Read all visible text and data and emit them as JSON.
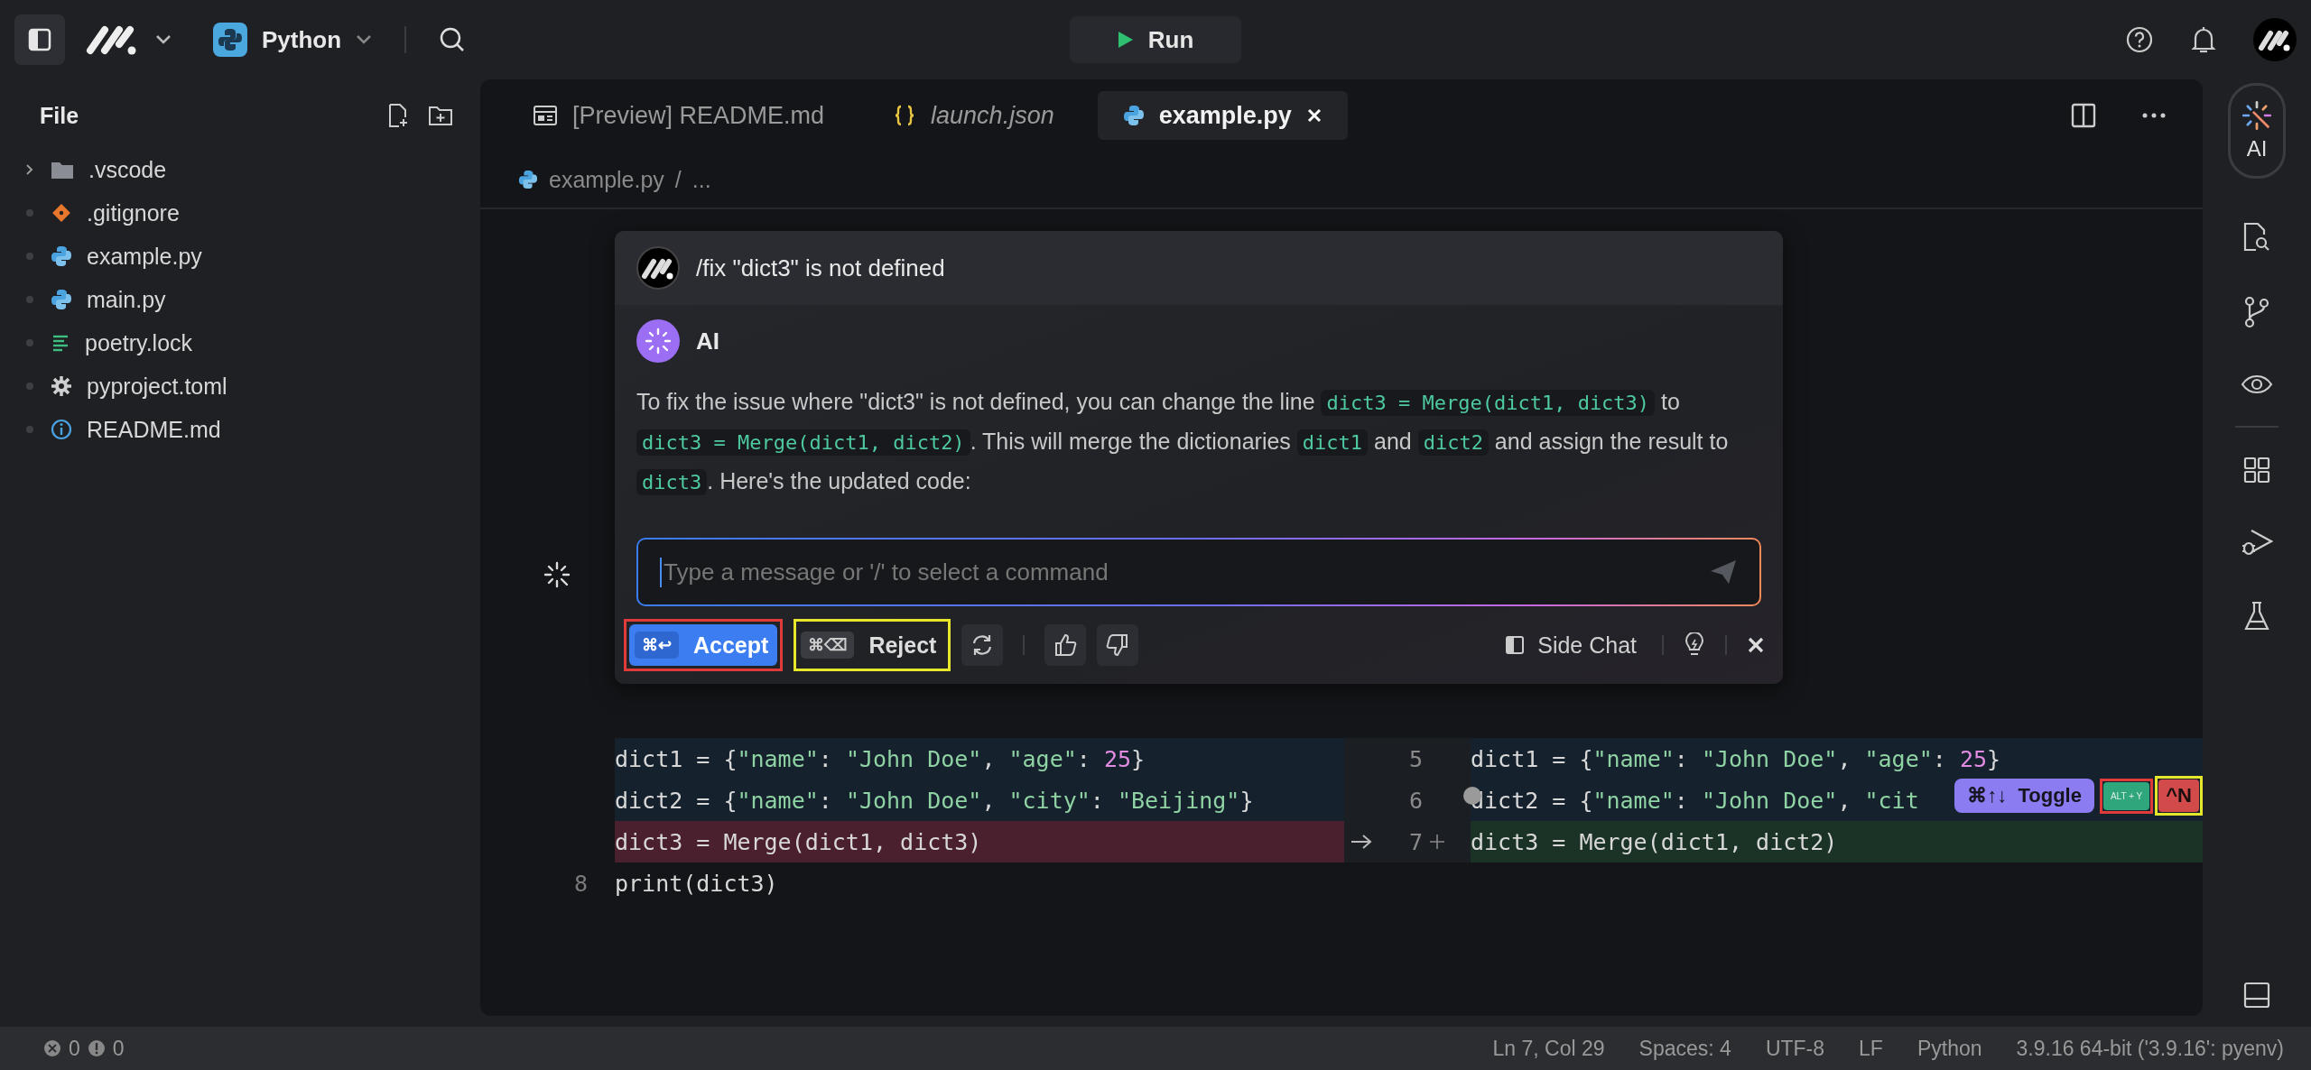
{
  "topbar": {
    "project": "Python",
    "run": "Run"
  },
  "sidebar": {
    "title": "File",
    "items": [
      {
        "name": ".vscode",
        "kind": "folder",
        "expanded": false
      },
      {
        "name": ".gitignore",
        "kind": "git"
      },
      {
        "name": "example.py",
        "kind": "python"
      },
      {
        "name": "main.py",
        "kind": "python"
      },
      {
        "name": "poetry.lock",
        "kind": "lock"
      },
      {
        "name": "pyproject.toml",
        "kind": "config"
      },
      {
        "name": "README.md",
        "kind": "info"
      }
    ]
  },
  "tabs": [
    {
      "label": "[Preview] README.md",
      "kind": "preview",
      "italic": false,
      "selected": false
    },
    {
      "label": "launch.json",
      "kind": "json",
      "italic": true,
      "selected": false
    },
    {
      "label": "example.py",
      "kind": "python",
      "italic": false,
      "selected": true
    }
  ],
  "breadcrumb": {
    "items": [
      "example.py",
      "..."
    ],
    "separator": "/"
  },
  "chat": {
    "command": "/fix \"dict3\" is not defined",
    "assistant": "AI",
    "message": [
      {
        "text": "To fix the issue where \"dict3\" is not defined, you can change the line ",
        "code": false
      },
      {
        "text": "dict3 = Merge(dict1, dict3)",
        "code": true
      },
      {
        "text": " to ",
        "code": false
      },
      {
        "text": "dict3 = Merge(dict1, dict2)",
        "code": true
      },
      {
        "text": ". This will merge the dictionaries ",
        "code": false
      },
      {
        "text": "dict1",
        "code": true
      },
      {
        "text": " and ",
        "code": false
      },
      {
        "text": "dict2",
        "code": true
      },
      {
        "text": " and assign the result to ",
        "code": false
      },
      {
        "text": "dict3",
        "code": true
      },
      {
        "text": ". Here's the updated code:",
        "code": false
      }
    ],
    "placeholder": "Type a message or '/' to select a command",
    "accept": {
      "shortcut": "⌘↩",
      "label": "Accept"
    },
    "reject": {
      "shortcut": "⌘⌫",
      "label": "Reject"
    },
    "side_chat": "Side Chat"
  },
  "diff": {
    "rows": [
      {
        "left": {
          "kind": "context",
          "tokens": [
            {
              "text": "dict1 = {",
              "kind": "plain"
            },
            {
              "text": "\"name\"",
              "kind": "string"
            },
            {
              "text": ": ",
              "kind": "plain"
            },
            {
              "text": "\"John Doe\"",
              "kind": "string"
            },
            {
              "text": ", ",
              "kind": "plain"
            },
            {
              "text": "\"age\"",
              "kind": "string"
            },
            {
              "text": ": ",
              "kind": "plain"
            },
            {
              "text": "25",
              "kind": "number"
            },
            {
              "text": "}",
              "kind": "plain"
            }
          ]
        },
        "right": {
          "number": "5",
          "kind": "context",
          "tokens": [
            {
              "text": "dict1 = {",
              "kind": "plain"
            },
            {
              "text": "\"name\"",
              "kind": "string"
            },
            {
              "text": ": ",
              "kind": "plain"
            },
            {
              "text": "\"John Doe\"",
              "kind": "string"
            },
            {
              "text": ", ",
              "kind": "plain"
            },
            {
              "text": "\"age\"",
              "kind": "string"
            },
            {
              "text": ": ",
              "kind": "plain"
            },
            {
              "text": "25",
              "kind": "number"
            },
            {
              "text": "}",
              "kind": "plain"
            }
          ]
        }
      },
      {
        "left": {
          "kind": "context",
          "tokens": [
            {
              "text": "dict2 = {",
              "kind": "plain"
            },
            {
              "text": "\"name\"",
              "kind": "string"
            },
            {
              "text": ": ",
              "kind": "plain"
            },
            {
              "text": "\"John Doe\"",
              "kind": "string"
            },
            {
              "text": ", ",
              "kind": "plain"
            },
            {
              "text": "\"city\"",
              "kind": "string"
            },
            {
              "text": ": ",
              "kind": "plain"
            },
            {
              "text": "\"Beijing\"",
              "kind": "string"
            },
            {
              "text": "}",
              "kind": "plain"
            }
          ]
        },
        "right": {
          "number": "6",
          "kind": "context",
          "hint": true,
          "tokens": [
            {
              "text": "dict2 = {",
              "kind": "plain"
            },
            {
              "text": "\"name\"",
              "kind": "string"
            },
            {
              "text": ": ",
              "kind": "plain"
            },
            {
              "text": "\"John Doe\"",
              "kind": "string"
            },
            {
              "text": ", ",
              "kind": "plain"
            },
            {
              "text": "\"cit",
              "kind": "string"
            }
          ]
        }
      },
      {
        "left": {
          "kind": "removed",
          "tokens": [
            {
              "text": "dict3 = Merge(dict1, dict3)",
              "kind": "plain"
            }
          ]
        },
        "right": {
          "number": "7",
          "kind": "added",
          "tokens": [
            {
              "text": "dict3 = Merge(dict1, dict2)",
              "kind": "plain"
            }
          ]
        }
      },
      {
        "left": {
          "number": "8",
          "kind": "plain",
          "tokens": [
            {
              "text": "print(dict3)",
              "kind": "plain"
            }
          ]
        },
        "right": {
          "kind": "empty"
        }
      }
    ]
  },
  "toggle_hint": {
    "shortcut": "⌘↑↓",
    "label": "Toggle",
    "accept_key": "ALT + Y",
    "next_key": "^N"
  },
  "activity_bar": {
    "ai_label": "AI"
  },
  "status_bar": {
    "errors": "0",
    "warnings": "0",
    "items": [
      "Ln 7, Col 29",
      "Spaces: 4",
      "UTF-8",
      "LF",
      "Python",
      "3.9.16 64-bit ('3.9.16': pyenv)"
    ]
  }
}
